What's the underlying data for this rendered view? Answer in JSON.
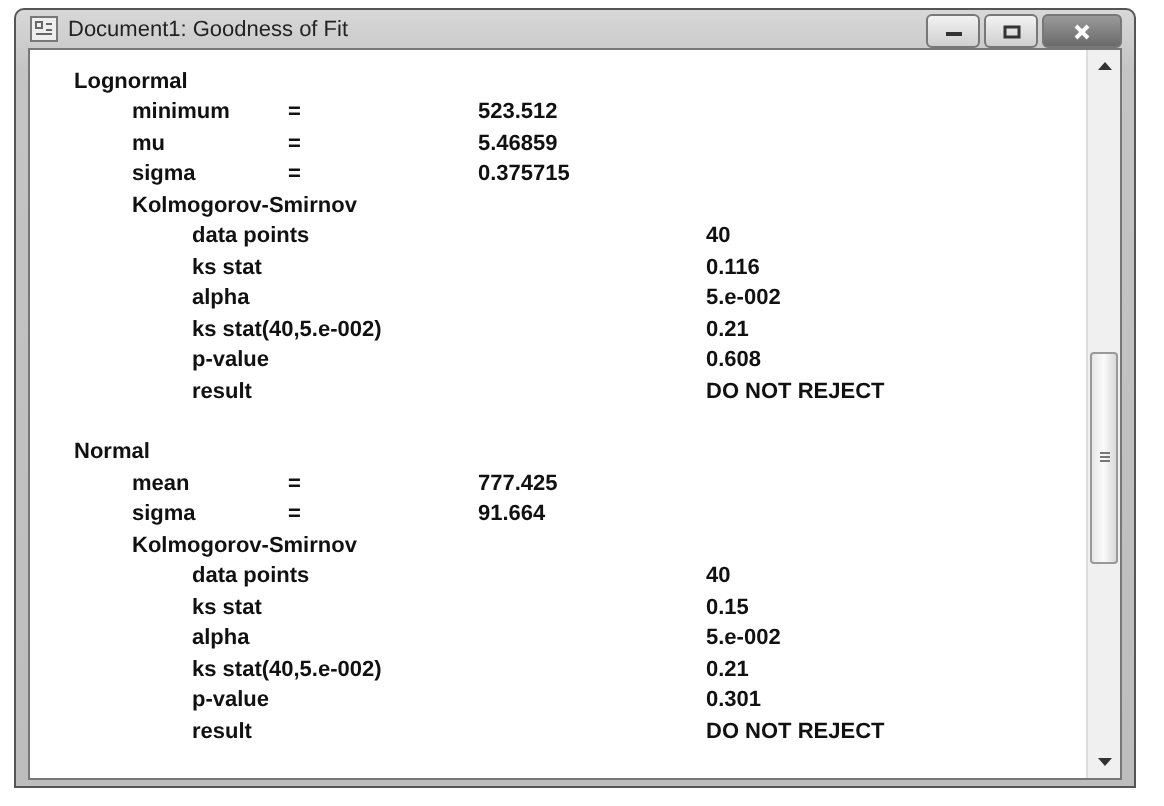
{
  "window": {
    "title": "Document1: Goodness of Fit"
  },
  "sections": [
    {
      "name": "Lognormal",
      "params": [
        {
          "label": "minimum",
          "sign": "=",
          "value": "523.512"
        },
        {
          "label": "mu",
          "sign": "=",
          "value": "5.46859"
        },
        {
          "label": "sigma",
          "sign": "=",
          "value": "0.375715"
        }
      ],
      "test": {
        "name": "Kolmogorov-Smirnov",
        "rows": [
          {
            "label": "data points",
            "value": "40"
          },
          {
            "label": "ks stat",
            "value": "0.116"
          },
          {
            "label": "alpha",
            "value": "5.e-002"
          },
          {
            "label": "ks stat(40,5.e-002)",
            "value": "0.21"
          },
          {
            "label": "p-value",
            "value": "0.608"
          },
          {
            "label": "result",
            "value": "DO NOT REJECT"
          }
        ]
      }
    },
    {
      "name": "Normal",
      "params": [
        {
          "label": "mean",
          "sign": "=",
          "value": "777.425"
        },
        {
          "label": "sigma",
          "sign": "=",
          "value": "91.664"
        }
      ],
      "test": {
        "name": "Kolmogorov-Smirnov",
        "rows": [
          {
            "label": "data points",
            "value": "40"
          },
          {
            "label": "ks stat",
            "value": "0.15"
          },
          {
            "label": "alpha",
            "value": "5.e-002"
          },
          {
            "label": "ks stat(40,5.e-002)",
            "value": "0.21"
          },
          {
            "label": "p-value",
            "value": "0.301"
          },
          {
            "label": "result",
            "value": "DO NOT REJECT"
          }
        ]
      }
    }
  ]
}
